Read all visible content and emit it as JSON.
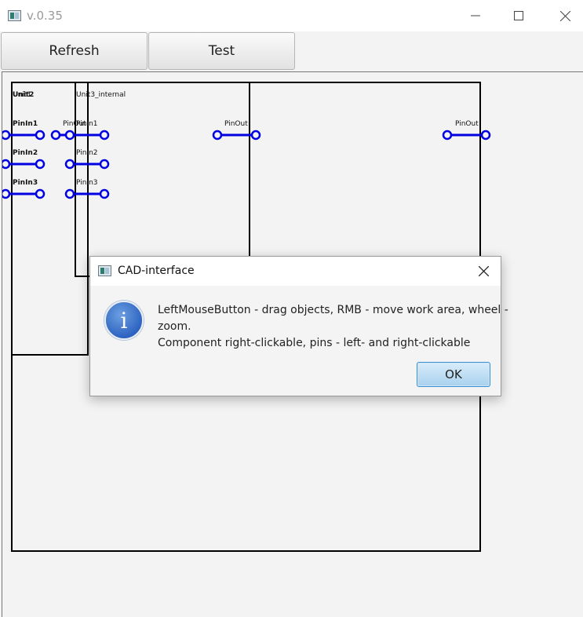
{
  "window": {
    "title": "v.0.35"
  },
  "toolbar": {
    "refresh_label": "Refresh",
    "test_label": "Test"
  },
  "canvas": {
    "units": [
      {
        "name": "Unit2",
        "inputs": [
          "PinIn1",
          "PinIn2",
          "PinIn3"
        ],
        "output": "PinOut"
      },
      {
        "name": "Unit1",
        "inputs": [],
        "output": "PinOut"
      },
      {
        "name": "Unit3_internal",
        "inputs": [
          "PinIn1",
          "PinIn2",
          "PinIn3"
        ],
        "output": "PinOut"
      }
    ],
    "pin_color": "#0000e0"
  },
  "dialog": {
    "title": "CAD-interface",
    "message_line1": "LeftMouseButton - drag objects, RMB - move work area, wheel -",
    "message_line2": "zoom.",
    "message_line3": "Component right-clickable, pins - left- and right-clickable",
    "ok_label": "OK",
    "icon": "info-icon"
  }
}
